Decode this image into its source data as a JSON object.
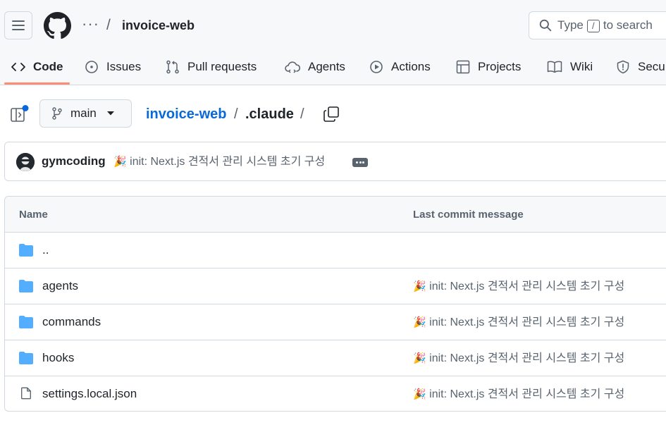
{
  "header": {
    "repo_name": "invoice-web",
    "more": "···",
    "separator": "/",
    "search": {
      "prefix": "Type",
      "key": "/",
      "suffix": "to search"
    }
  },
  "tabs": [
    {
      "label": "Code",
      "icon": "code-icon",
      "active": true
    },
    {
      "label": "Issues",
      "icon": "issue-icon"
    },
    {
      "label": "Pull requests",
      "icon": "pull-request-icon"
    },
    {
      "label": "Agents",
      "icon": "agents-icon"
    },
    {
      "label": "Actions",
      "icon": "play-icon"
    },
    {
      "label": "Projects",
      "icon": "table-icon"
    },
    {
      "label": "Wiki",
      "icon": "book-icon"
    },
    {
      "label": "Secu",
      "icon": "shield-icon"
    }
  ],
  "path": {
    "branch": "main",
    "repo": "invoice-web",
    "sep": "/",
    "dir": ".claude"
  },
  "latest_commit": {
    "author": "gymcoding",
    "emoji": "🎉",
    "message": "init: Next.js 견적서 관리 시스템 초기 구성"
  },
  "table": {
    "col_name": "Name",
    "col_message": "Last commit message",
    "rows": [
      {
        "name": "..",
        "type": "folder",
        "message": "",
        "emoji": ""
      },
      {
        "name": "agents",
        "type": "folder",
        "emoji": "🎉",
        "message": "init: Next.js 견적서 관리 시스템 초기 구성"
      },
      {
        "name": "commands",
        "type": "folder",
        "emoji": "🎉",
        "message": "init: Next.js 견적서 관리 시스템 초기 구성"
      },
      {
        "name": "hooks",
        "type": "folder",
        "emoji": "🎉",
        "message": "init: Next.js 견적서 관리 시스템 초기 구성"
      },
      {
        "name": "settings.local.json",
        "type": "file",
        "emoji": "🎉",
        "message": "init: Next.js 견적서 관리 시스템 초기 구성"
      }
    ]
  },
  "colors": {
    "link": "#0969da",
    "folder": "#54aeff",
    "tab_underline": "#fd8c73",
    "notification_dot": "#0969da"
  }
}
